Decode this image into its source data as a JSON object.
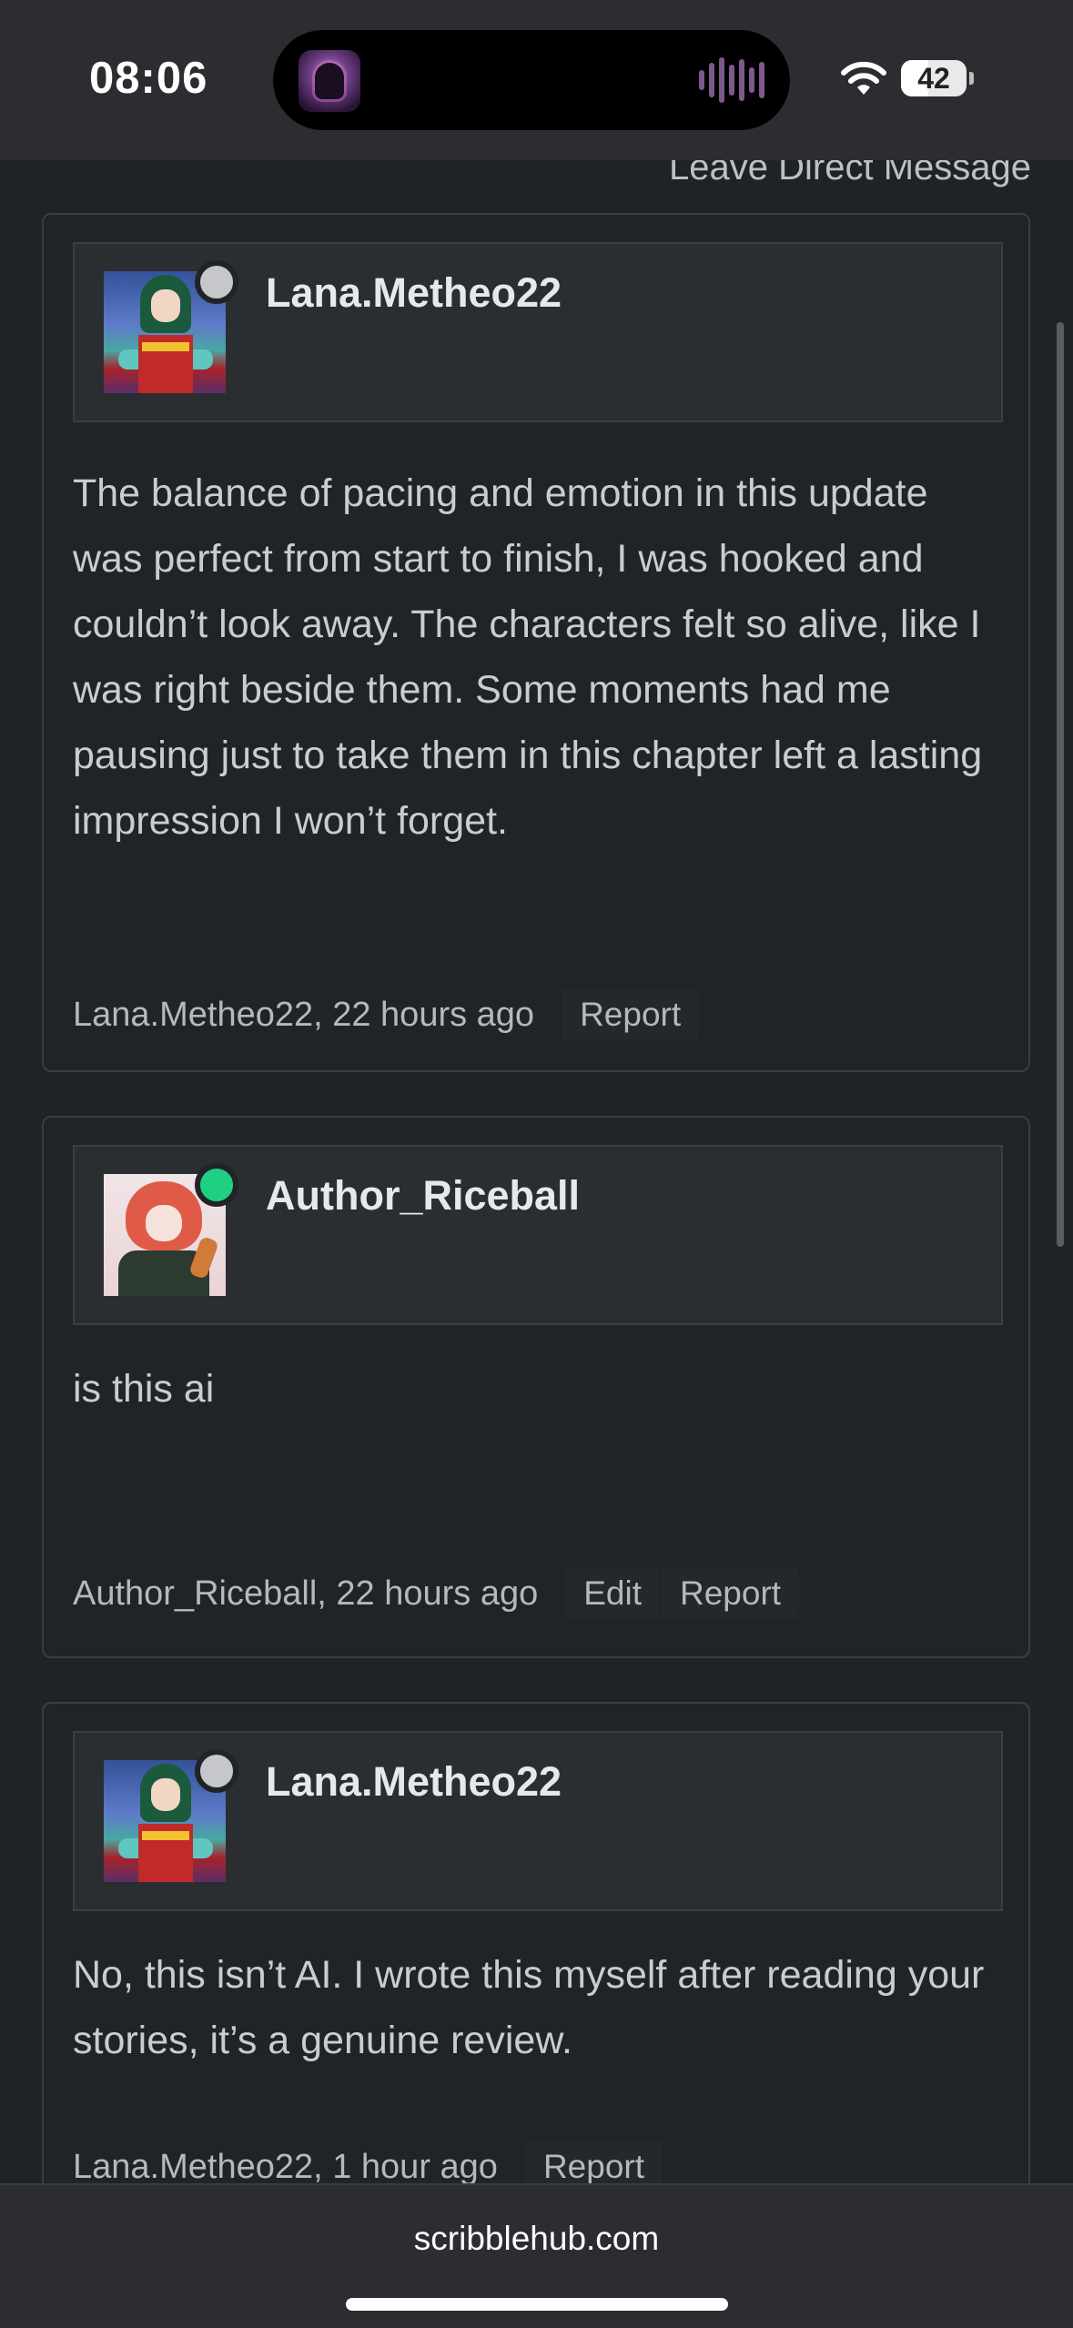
{
  "status_bar": {
    "time": "08:06",
    "battery": "42",
    "battery_level": 0.42
  },
  "header": {
    "leave_dm": "Leave Direct Message"
  },
  "comments": [
    {
      "username": "Lana.Metheo22",
      "online": false,
      "text": "The balance of pacing and emotion in this update was perfect from start to finish, I was hooked and couldn’t look away. The characters felt so alive, like I was right beside them. Some moments had me pausing just to take them in this chapter left a lasting impression I won’t forget.",
      "meta": "Lana.Metheo22, 22 hours ago",
      "actions": [
        "Report"
      ]
    },
    {
      "username": "Author_Riceball",
      "online": true,
      "text": "is this ai",
      "meta": "Author_Riceball, 22 hours ago",
      "actions": [
        "Edit",
        "Report"
      ]
    },
    {
      "username": "Lana.Metheo22",
      "online": false,
      "text": "No, this isn’t AI. I wrote this myself after reading your stories, it’s a genuine review.",
      "meta": "Lana.Metheo22, 1 hour ago",
      "actions": [
        "Report"
      ]
    }
  ],
  "colors": {
    "online": "#1fd083",
    "offline": "#c5c7ca"
  },
  "browser": {
    "url": "scribblehub.com"
  }
}
